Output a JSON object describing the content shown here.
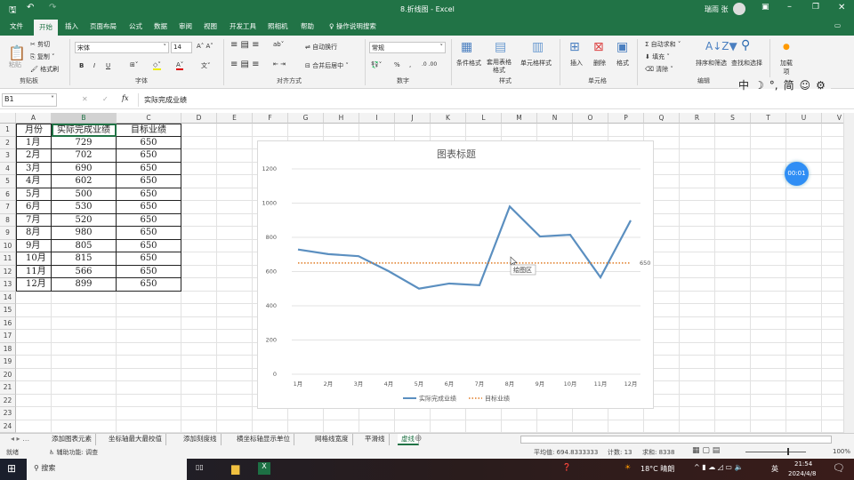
{
  "titlebar": {
    "file": "8.折线图",
    "app": "Excel",
    "user": "瑞雨 张"
  },
  "tabs": [
    "文件",
    "开始",
    "插入",
    "页面布局",
    "公式",
    "数据",
    "审阅",
    "视图",
    "开发工具",
    "照相机",
    "帮助"
  ],
  "tell_me": "操作说明搜索",
  "ribbon": {
    "clipboard": {
      "paste": "粘贴",
      "cut": "剪切",
      "copy": "复制",
      "format_painter": "格式刷",
      "label": "剪贴板"
    },
    "font": {
      "name": "宋体",
      "size": "14",
      "bold": "B",
      "italic": "I",
      "underline": "U",
      "label": "字体"
    },
    "alignment": {
      "wrap": "自动换行",
      "merge": "合并后居中",
      "label": "对齐方式"
    },
    "number": {
      "format": "常规",
      "percent": "%",
      "comma": ",",
      "label": "数字"
    },
    "styles": {
      "conditional": "条件格式",
      "table": "套用表格格式",
      "cell": "单元格样式",
      "label": "样式"
    },
    "cells": {
      "insert": "插入",
      "delete": "删除",
      "format": "格式",
      "label": "单元格"
    },
    "editing": {
      "autosum": "自动求和",
      "fill": "填充",
      "clear": "清除",
      "sort": "排序和筛选",
      "find": "查找和选择",
      "label": "编辑"
    },
    "addins": {
      "label": "加载项"
    }
  },
  "ime": [
    "中",
    "☽",
    "°,",
    "简",
    "☺",
    "⚙"
  ],
  "formula": {
    "name_box": "B1",
    "fx": "fx",
    "value": "实际完成业绩"
  },
  "columns": [
    "A",
    "B",
    "C",
    "D",
    "E",
    "F",
    "G",
    "H",
    "I",
    "J",
    "K",
    "L",
    "M",
    "N",
    "O",
    "P",
    "Q",
    "R",
    "S",
    "T",
    "U",
    "V"
  ],
  "table": {
    "headers": [
      "月份",
      "实际完成业绩",
      "目标业绩"
    ],
    "rows": [
      [
        "1月",
        "729",
        "650"
      ],
      [
        "2月",
        "702",
        "650"
      ],
      [
        "3月",
        "690",
        "650"
      ],
      [
        "4月",
        "602",
        "650"
      ],
      [
        "5月",
        "500",
        "650"
      ],
      [
        "6月",
        "530",
        "650"
      ],
      [
        "7月",
        "520",
        "650"
      ],
      [
        "8月",
        "980",
        "650"
      ],
      [
        "9月",
        "805",
        "650"
      ],
      [
        "10月",
        "815",
        "650"
      ],
      [
        "11月",
        "566",
        "650"
      ],
      [
        "12月",
        "899",
        "650"
      ]
    ]
  },
  "chart_data": {
    "type": "line",
    "title": "图表标题",
    "categories": [
      "1月",
      "2月",
      "3月",
      "4月",
      "5月",
      "6月",
      "7月",
      "8月",
      "9月",
      "10月",
      "11月",
      "12月"
    ],
    "series": [
      {
        "name": "实际完成业绩",
        "values": [
          729,
          702,
          690,
          602,
          500,
          530,
          520,
          980,
          805,
          815,
          566,
          899
        ],
        "color": "#5b8fc0",
        "style": "solid"
      },
      {
        "name": "目标业绩",
        "values": [
          650,
          650,
          650,
          650,
          650,
          650,
          650,
          650,
          650,
          650,
          650,
          650
        ],
        "color": "#e07b24",
        "style": "dotted"
      }
    ],
    "yticks": [
      "0",
      "200",
      "400",
      "600",
      "800",
      "1000",
      "1200"
    ],
    "ylim": [
      0,
      1200
    ],
    "data_label": "650",
    "tooltip": "绘图区",
    "legend": "bottom",
    "grid": true
  },
  "timer": "00:01",
  "sheet_tabs": [
    "添加图表元素",
    "坐标轴最大最校值",
    "添加刻度线",
    "横坐标轴显示单位",
    "网格线宽度",
    "平滑线",
    "虚线"
  ],
  "active_sheet": "虚线",
  "status": {
    "ready": "就绪",
    "accessibility": "辅助功能: 调查",
    "average": "平均值: 694.8333333",
    "count": "计数: 13",
    "sum": "求和: 8338",
    "zoom": "100%"
  },
  "taskbar": {
    "search": "搜索",
    "weather": "18°C 晴朗",
    "lang": "英",
    "time": "21:54",
    "date": "2024/4/8"
  }
}
